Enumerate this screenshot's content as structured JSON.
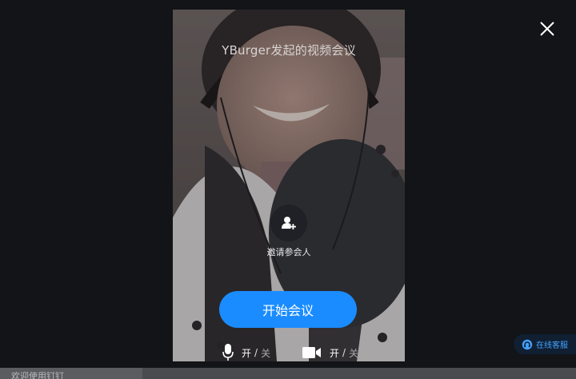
{
  "meeting": {
    "title": "YBurger发起的视频会议",
    "invite_label": "邀请参会人",
    "start_label": "开始会议"
  },
  "controls": {
    "mic": {
      "on_label": "开",
      "separator": "/",
      "off_label": "关",
      "icon": "microphone-icon"
    },
    "camera": {
      "on_label": "开",
      "separator": "/",
      "off_label": "关",
      "icon": "video-camera-icon"
    }
  },
  "service": {
    "label": "在线客服",
    "icon": "headset-icon",
    "color": "#41a3ff"
  },
  "footer": {
    "welcome_text": "欢迎使用钉钉"
  },
  "colors": {
    "accent": "#1a8cff",
    "background": "#121417",
    "close_icon": "#ffffff"
  }
}
